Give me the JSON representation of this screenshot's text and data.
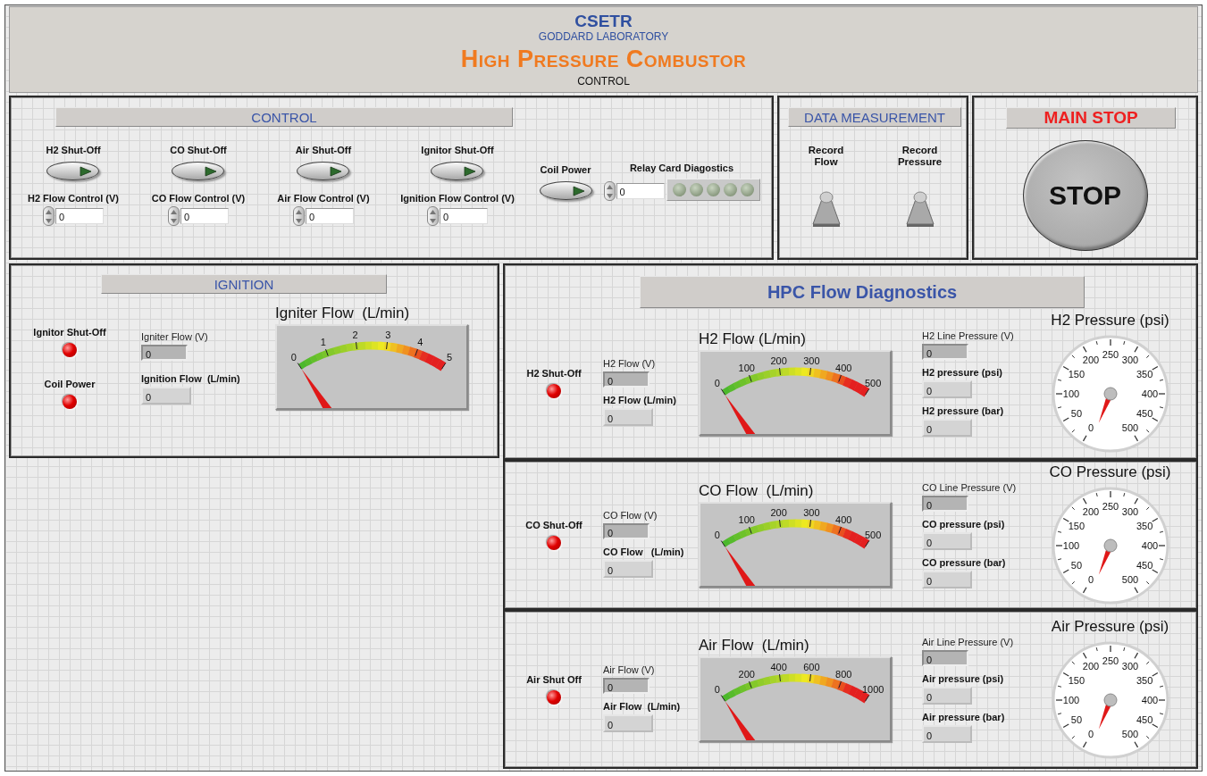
{
  "header": {
    "title": "CSETR",
    "subtitle": "GODDARD LABORATORY",
    "main_title": "High Pressure Combustor",
    "caption": "CONTROL"
  },
  "control": {
    "title": "CONTROL",
    "channels": [
      {
        "switch": {
          "label": "H2 Shut-Off",
          "on": false
        },
        "flow_control": {
          "label": "H2 Flow Control (V)",
          "value": "0"
        }
      },
      {
        "switch": {
          "label": "CO Shut-Off",
          "on": false
        },
        "flow_control": {
          "label": "CO Flow Control (V)",
          "value": "0"
        }
      },
      {
        "switch": {
          "label": "Air Shut-Off",
          "on": false
        },
        "flow_control": {
          "label": "Air Flow Control (V)",
          "value": "0"
        }
      },
      {
        "switch": {
          "label": "Ignitor Shut-Off",
          "on": false
        },
        "flow_control": {
          "label": "Ignition Flow Control (V)",
          "value": "0"
        }
      }
    ],
    "coil_power": {
      "label": "Coil Power",
      "on": false
    },
    "relay": {
      "label": "Relay Card Diagostics",
      "value": "0",
      "leds": [
        {
          "on": false
        },
        {
          "on": false
        },
        {
          "on": false
        },
        {
          "on": false
        },
        {
          "on": false
        }
      ]
    }
  },
  "data_measurement": {
    "title": "DATA MEASUREMENT",
    "switches": [
      {
        "label": "Record Flow",
        "on": false
      },
      {
        "label": "Record Pressure",
        "on": false
      }
    ]
  },
  "main_stop": {
    "title": "MAIN STOP",
    "button": "STOP"
  },
  "ignition": {
    "title": "IGNITION",
    "leds": [
      {
        "label": "Ignitor Shut-Off",
        "on": true
      },
      {
        "label": "Coil Power",
        "on": true
      }
    ],
    "indicators": [
      {
        "kind": "sensor",
        "label": "Igniter Flow (V)",
        "value": "0"
      },
      {
        "kind": "derived",
        "label": "Ignition Flow  (L/min)",
        "value": "0"
      }
    ],
    "meter": {
      "title": "Igniter Flow  (L/min)",
      "ticks": [
        "0",
        "1",
        "2",
        "3",
        "4",
        "5"
      ]
    }
  },
  "diagnostics": {
    "title": "HPC Flow Diagnostics",
    "lines": [
      {
        "led": {
          "label": "H2 Shut-Off",
          "on": true
        },
        "indicators": [
          {
            "kind": "sensor",
            "label": "H2 Flow (V)",
            "value": "0"
          },
          {
            "kind": "derived",
            "label": "H2 Flow (L/min)",
            "value": "0"
          }
        ],
        "meter": {
          "title": "H2 Flow (L/min)",
          "ticks": [
            "0",
            "100",
            "200",
            "300",
            "400",
            "500"
          ]
        },
        "pressures": [
          {
            "kind": "sensor",
            "label": "H2 Line Pressure (V)",
            "value": "0"
          },
          {
            "kind": "derived",
            "label": "H2 pressure (psi)",
            "value": "0"
          },
          {
            "kind": "derived",
            "label": "H2 pressure (bar)",
            "value": "0"
          }
        ],
        "dial": {
          "title": "H2 Pressure (psi)",
          "ticks": [
            "250",
            "200",
            "300",
            "150",
            "350",
            "100",
            "400",
            "50",
            "450",
            "0",
            "500"
          ]
        }
      },
      {
        "led": {
          "label": "CO Shut-Off",
          "on": true
        },
        "indicators": [
          {
            "kind": "sensor",
            "label": "CO Flow (V)",
            "value": "0"
          },
          {
            "kind": "derived",
            "label": "CO Flow   (L/min)",
            "value": "0"
          }
        ],
        "meter": {
          "title": "CO Flow  (L/min)",
          "ticks": [
            "0",
            "100",
            "200",
            "300",
            "400",
            "500"
          ]
        },
        "pressures": [
          {
            "kind": "sensor",
            "label": "CO Line Pressure (V)",
            "value": "0"
          },
          {
            "kind": "derived",
            "label": "CO pressure (psi)",
            "value": "0"
          },
          {
            "kind": "derived",
            "label": "CO pressure (bar)",
            "value": "0"
          }
        ],
        "dial": {
          "title": "CO Pressure (psi)",
          "ticks": [
            "250",
            "200",
            "300",
            "150",
            "350",
            "100",
            "400",
            "50",
            "450",
            "0",
            "500"
          ]
        }
      },
      {
        "led": {
          "label": "Air Shut Off",
          "on": true
        },
        "indicators": [
          {
            "kind": "sensor",
            "label": "Air Flow (V)",
            "value": "0"
          },
          {
            "kind": "derived",
            "label": "Air Flow  (L/min)",
            "value": "0"
          }
        ],
        "meter": {
          "title": "Air Flow  (L/min)",
          "ticks": [
            "0",
            "200",
            "400",
            "600",
            "800",
            "1000"
          ]
        },
        "pressures": [
          {
            "kind": "sensor",
            "label": "Air Line Pressure (V)",
            "value": "0"
          },
          {
            "kind": "derived",
            "label": "Air pressure (psi)",
            "value": "0"
          },
          {
            "kind": "derived",
            "label": "Air pressure (bar)",
            "value": "0"
          }
        ],
        "dial": {
          "title": "Air Pressure (psi)",
          "ticks": [
            "250",
            "200",
            "300",
            "150",
            "350",
            "100",
            "400",
            "50",
            "450",
            "0",
            "500"
          ]
        }
      }
    ]
  }
}
